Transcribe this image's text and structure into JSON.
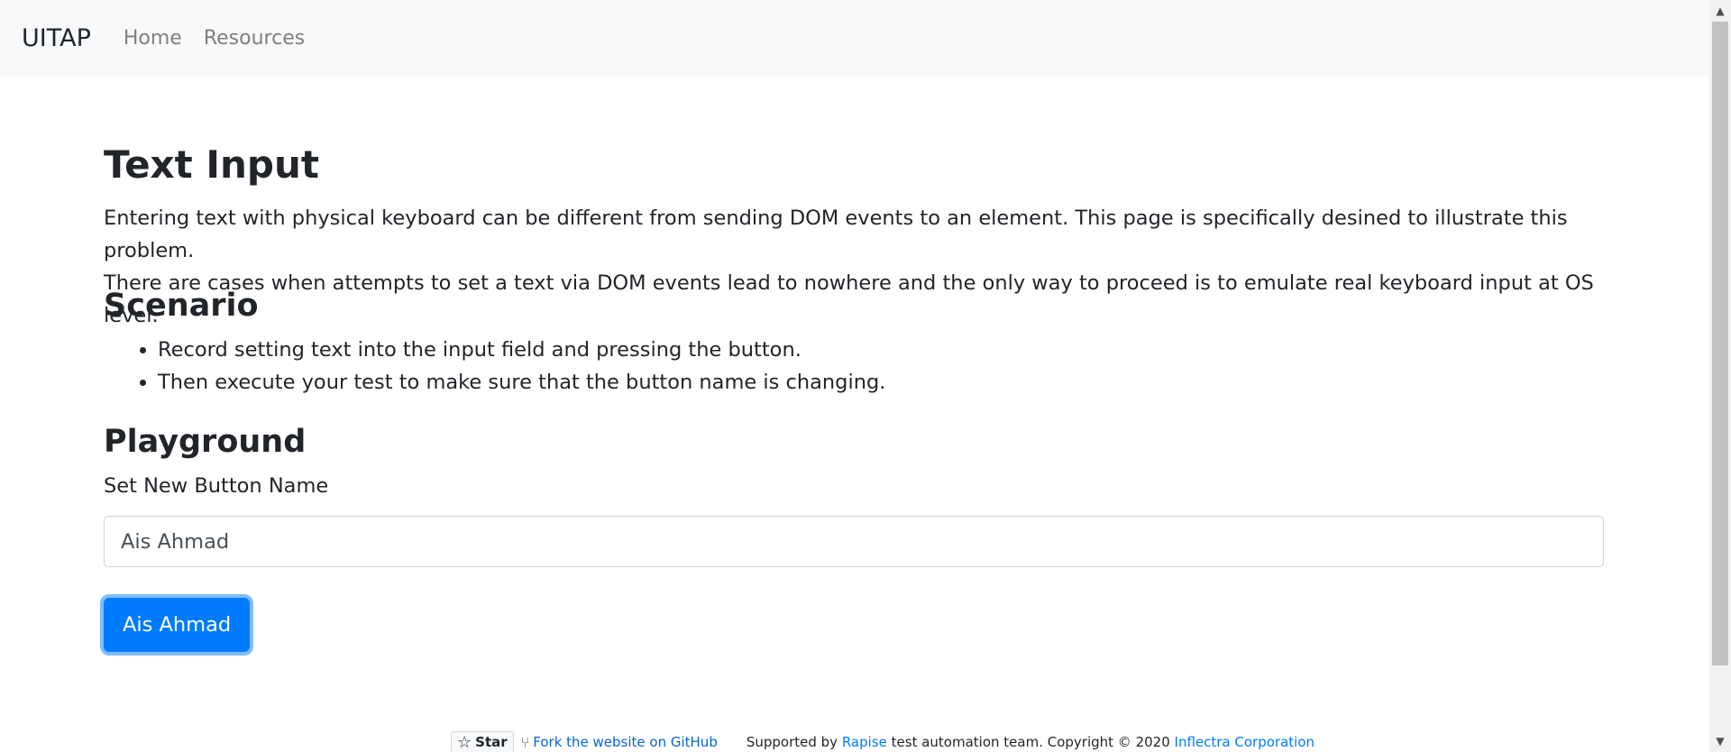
{
  "navbar": {
    "brand": "UITAP",
    "links": [
      "Home",
      "Resources"
    ]
  },
  "main": {
    "title": "Text Input",
    "description_line1": "Entering text with physical keyboard can be different from sending DOM events to an element. This page is specifically desined to illustrate this problem.",
    "description_line2": "There are cases when attempts to set a text via DOM events lead to nowhere and the only way to proceed is to emulate real keyboard input at OS level.",
    "scenario_heading": "Scenario",
    "scenario_items": [
      "Record setting text into the input field and pressing the button.",
      "Then execute your test to make sure that the button name is changing."
    ],
    "playground_heading": "Playground",
    "field_label": "Set New Button Name",
    "input_value": "Ais Ahmad",
    "button_label": "Ais Ahmad"
  },
  "footer": {
    "star_label": "Star",
    "fork_link": "Fork the website on GitHub",
    "supported_prefix": "Supported by",
    "rapise_link": "Rapise",
    "supported_middle": "test automation team. Copyright © 2020",
    "inflectra_link": "Inflectra Corporation"
  },
  "colors": {
    "primary": "#007bff",
    "navbar_bg": "#f8f9fa",
    "text": "#212529"
  }
}
